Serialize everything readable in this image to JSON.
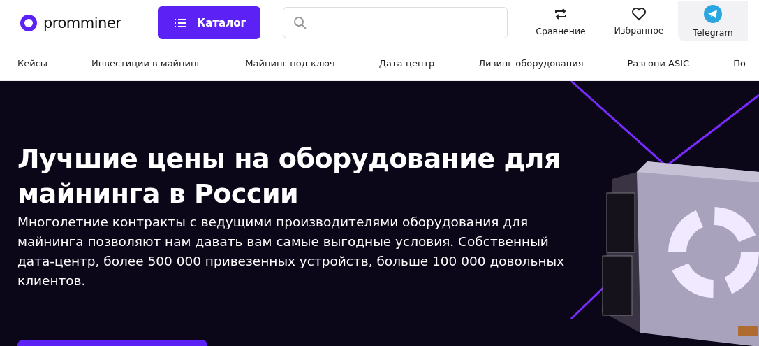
{
  "logo": {
    "text": "promminer"
  },
  "catalog_button": {
    "label": "Каталог"
  },
  "header_actions": [
    {
      "kind": "compare",
      "label": "Сравнение",
      "selected": false
    },
    {
      "kind": "favorite",
      "label": "Избранное",
      "selected": false
    },
    {
      "kind": "telegram",
      "label": "Telegram",
      "selected": true
    }
  ],
  "nav": [
    "Кейсы",
    "Инвестиции в майнинг",
    "Майнинг под ключ",
    "Дата-центр",
    "Лизинг оборудования",
    "Разгони ASIC",
    "По"
  ],
  "hero": {
    "title": "Лучшие цены на оборудование для майнинга в России",
    "text": "Многолетние контракты с ведущими производителями оборудования для майнинга позволяют нам давать вам самые выгодные условия. Собственный дата-центр, более 500 000 привезенных устройств, больше 100 000 довольных клиентов."
  }
}
